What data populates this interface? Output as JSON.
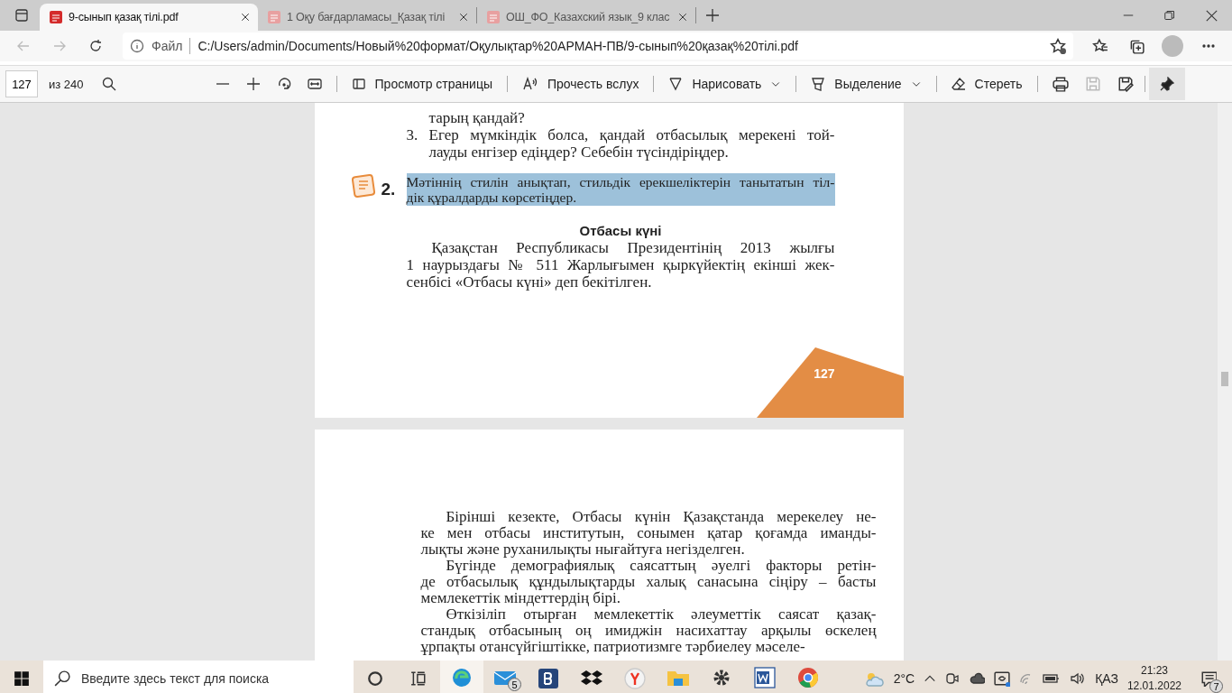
{
  "tabs": [
    {
      "title": "9-сынып қазақ тілі.pdf",
      "selected": true
    },
    {
      "title": "1 Оқу бағдарламасы_Қазақ тілі",
      "selected": false
    },
    {
      "title": "ОШ_ФО_Казахский язык_9 клас",
      "selected": false
    }
  ],
  "address": {
    "scheme": "Файл",
    "url": "C:/Users/admin/Documents/Новый%20формат/Оқулықтар%20АРМАН-ПВ/9-сынып%20қазақ%20тілі.pdf"
  },
  "pdf_toolbar": {
    "page": "127",
    "total": "из 240",
    "actions": [
      {
        "kind": "view",
        "label": "Просмотр страницы",
        "dropdown": false
      },
      {
        "kind": "read",
        "label": "Прочесть вслух",
        "dropdown": false
      },
      {
        "kind": "draw",
        "label": "Нарисовать",
        "dropdown": true
      },
      {
        "kind": "highlight",
        "label": "Выделение",
        "dropdown": true
      },
      {
        "kind": "erase",
        "label": "Стереть",
        "dropdown": false
      }
    ]
  },
  "pages": [
    {
      "page_number": "127",
      "blocks": [
        {
          "kind": "list_item",
          "lines": [
            "тарың қандай?"
          ]
        },
        {
          "kind": "list_item",
          "number": "3.",
          "lines": [
            "Егер мүмкіндік болса, қандай отбасылық мерекені той-",
            "лауды енгізер едіңдер? Себебін түсіндіріңдер."
          ]
        },
        {
          "kind": "task",
          "number": "2.",
          "highlighted": true,
          "lines": [
            "Мәтіннің стилін анықтап, стильдік ерекшеліктерін танытатын тіл-",
            "дік құралдарды көрсетіңдер."
          ]
        },
        {
          "kind": "heading",
          "text": "Отбасы күні"
        },
        {
          "kind": "paragraph",
          "lines": [
            "Қазақстан Республикасы Президентінің 2013 жылғы",
            "1 наурыздағы № 511 Жарлығымен қыркүйектің екінші жек-",
            "сенбісі «Отбасы күні» деп бекітілген."
          ]
        }
      ]
    },
    {
      "blocks": [
        {
          "kind": "paragraph",
          "lines": [
            "Бірінші кезекте, Отбасы күнін Қазақстанда мерекелеу не-",
            "ке мен отбасы институтын, сонымен қатар қоғамда иманды-",
            "лықты және руханилықты нығайтуға  негізделген."
          ]
        },
        {
          "kind": "paragraph",
          "lines": [
            "Бүгінде демографиялық саясаттың әуелгі факторы ретін-",
            "де отбасылық құндылықтарды халық санасына сіңіру – басты",
            "мемлекеттік міндеттердің бірі."
          ]
        },
        {
          "kind": "paragraph",
          "lines": [
            "Өткізіліп отырған мемлекеттік әлеуметтік саясат қазақ-",
            "стандық отбасының оң имиджін насихаттау арқылы өскелең",
            "ұрпақты отансүйгіштікке, патриотизмге тәрбиелеу мәселе-"
          ]
        }
      ]
    }
  ],
  "taskbar": {
    "search_placeholder": "Введите здесь текст для поиска",
    "apps": [
      {
        "kind": "edge",
        "selected": true,
        "running": true
      },
      {
        "kind": "mail",
        "badge": "5",
        "selected": false,
        "running": true
      },
      {
        "kind": "booking",
        "selected": false,
        "running": false
      },
      {
        "kind": "dropbox",
        "selected": false,
        "running": false
      },
      {
        "kind": "yandex",
        "selected": false,
        "running": false
      },
      {
        "kind": "explorer",
        "selected": false,
        "running": true
      },
      {
        "kind": "settings",
        "selected": false,
        "running": true
      },
      {
        "kind": "word",
        "selected": false,
        "running": true
      },
      {
        "kind": "chrome",
        "selected": false,
        "running": true
      }
    ],
    "temperature": "2°C",
    "language": "ҚАЗ",
    "time": "21:23",
    "date": "12.01.2022",
    "notifications": "7"
  }
}
